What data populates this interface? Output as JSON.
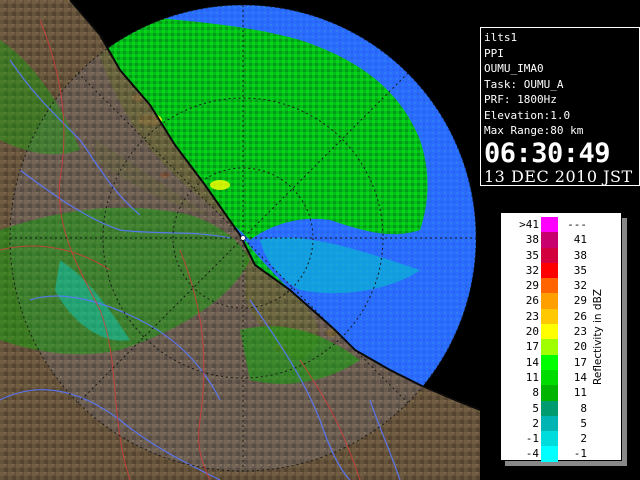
{
  "info": {
    "radar": "ilts1",
    "product": "PPI",
    "site": "OUMU_IMA0",
    "task": "Task: OUMU_A",
    "prf": "PRF: 1800Hz",
    "elevation": "Elevation:1.0",
    "max_range": "Max Range:80 km",
    "time": "06:30:49",
    "date": "13 DEC 2010 JST"
  },
  "legend": {
    "title": "Reflectivity in dBZ",
    "rows": [
      {
        "lo": ">41",
        "hi": "---",
        "color": "#ff00ff"
      },
      {
        "lo": "38",
        "hi": "41",
        "color": "#c8006e"
      },
      {
        "lo": "35",
        "hi": "38",
        "color": "#d2003c"
      },
      {
        "lo": "32",
        "hi": "35",
        "color": "#ff0000"
      },
      {
        "lo": "29",
        "hi": "32",
        "color": "#ff6400"
      },
      {
        "lo": "26",
        "hi": "29",
        "color": "#ffa000"
      },
      {
        "lo": "23",
        "hi": "26",
        "color": "#ffc800"
      },
      {
        "lo": "20",
        "hi": "23",
        "color": "#ffff00"
      },
      {
        "lo": "17",
        "hi": "20",
        "color": "#a0ff00"
      },
      {
        "lo": "14",
        "hi": "17",
        "color": "#00ff00"
      },
      {
        "lo": "11",
        "hi": "14",
        "color": "#00dc00"
      },
      {
        "lo": "8",
        "hi": "11",
        "color": "#00b400"
      },
      {
        "lo": "5",
        "hi": "8",
        "color": "#009b6e"
      },
      {
        "lo": "2",
        "hi": "5",
        "color": "#00b4b4"
      },
      {
        "lo": "-1",
        "hi": "2",
        "color": "#00dcdc"
      },
      {
        "lo": "-4",
        "hi": "-1",
        "color": "#00ffff"
      }
    ]
  },
  "map": {
    "colors": {
      "range_disk": "#2a6cff",
      "land": "#6e5a40",
      "sea_outside": "#000000",
      "coastline": "#101010",
      "rivers": "#5a78ff",
      "borders": "#d23c3c",
      "grid": "#202020"
    }
  }
}
